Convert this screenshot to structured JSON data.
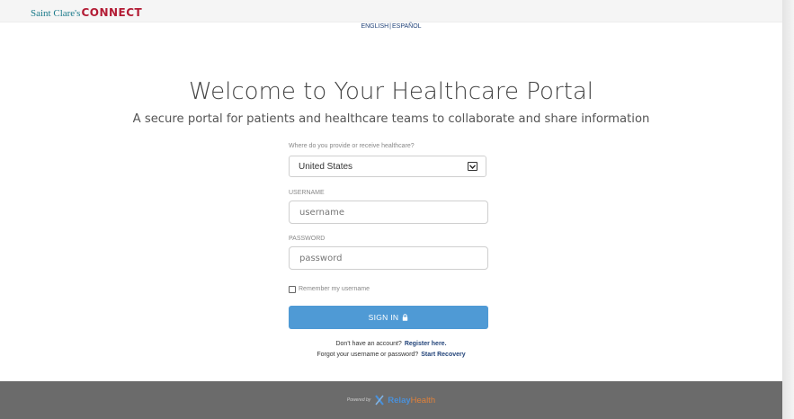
{
  "header": {
    "logo_script": "Saint Clare's",
    "logo_connect": "CONNECT"
  },
  "language": {
    "english": "ENGLISH",
    "separator": "|",
    "spanish": "ESPAÑOL"
  },
  "main": {
    "title": "Welcome to Your Healthcare Portal",
    "subtitle": "A secure portal for patients and healthcare teams to collaborate and share information"
  },
  "form": {
    "country_label": "Where do you provide or receive healthcare?",
    "country_value": "United States",
    "username_label": "USERNAME",
    "username_placeholder": "username",
    "password_label": "PASSWORD",
    "password_placeholder": "password",
    "remember_label": "Remember my username",
    "signin_label": "SIGN IN"
  },
  "help": {
    "no_account": "Don't have an account?",
    "register_link": "Register here.",
    "forgot": "Forgot your username or password?",
    "recovery_link": "Start Recovery"
  },
  "footer": {
    "powered_by": "Powered by",
    "brand_relay": "Relay",
    "brand_health": "Health"
  },
  "colors": {
    "brand_teal": "#1a7a8a",
    "brand_red": "#b31b34",
    "link_blue": "#23447a",
    "button_blue": "#4f9ad5",
    "footer_gray": "#6b6b6b",
    "relay_blue": "#4a90d9",
    "health_orange": "#e0813a"
  },
  "icons": {
    "lock": "lock-icon",
    "dropdown": "chevron-down-icon",
    "relay_logo": "relayhealth-logo-icon"
  }
}
